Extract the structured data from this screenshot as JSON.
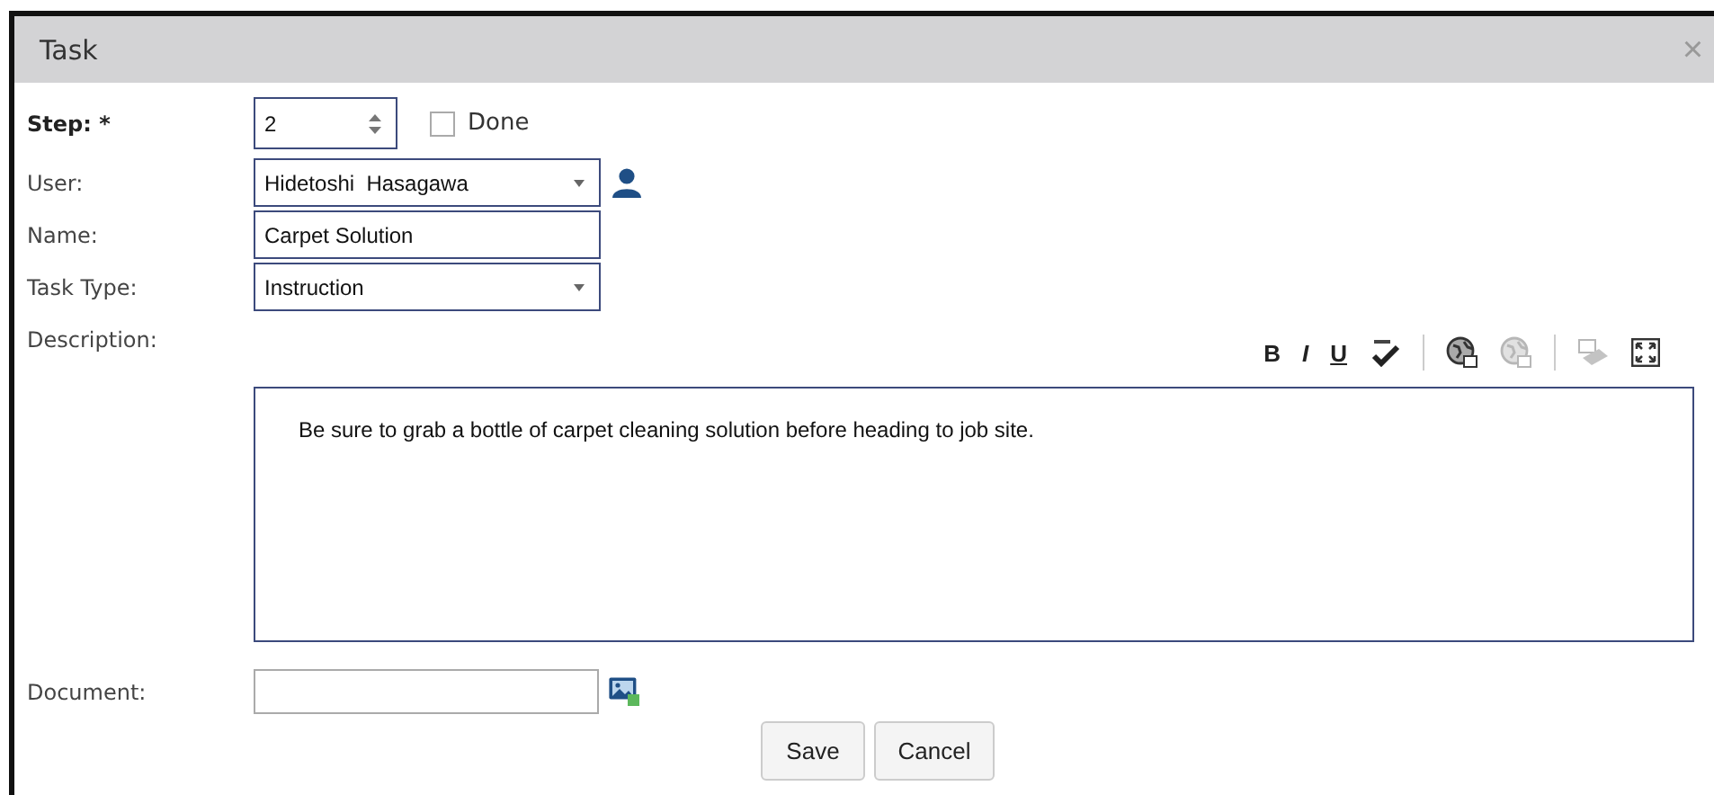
{
  "window": {
    "title": "Task",
    "close": "×"
  },
  "step": {
    "label": "Step:",
    "required_mark": "*",
    "value": "2"
  },
  "done": {
    "label": "Done",
    "checked": false
  },
  "user": {
    "label": "User:",
    "value": "Hidetoshi  Hasagawa"
  },
  "name": {
    "label": "Name:",
    "value": "Carpet Solution"
  },
  "task_type": {
    "label": "Task Type:",
    "value": "Instruction"
  },
  "description": {
    "label": "Description:",
    "text": "Be sure to grab a bottle of carpet cleaning solution before heading to job site.",
    "toolbar": [
      {
        "kind": "bold",
        "label": "B",
        "disabled": false
      },
      {
        "kind": "italic",
        "label": "I",
        "disabled": false
      },
      {
        "kind": "underline",
        "label": "U",
        "disabled": false
      },
      {
        "kind": "spellcheck",
        "disabled": false
      },
      {
        "kind": "separator"
      },
      {
        "kind": "globe",
        "disabled": false
      },
      {
        "kind": "globe",
        "disabled": true
      },
      {
        "kind": "separator"
      },
      {
        "kind": "paste",
        "disabled": true
      },
      {
        "kind": "fullscreen",
        "disabled": false
      }
    ]
  },
  "document": {
    "label": "Document:"
  },
  "buttons": [
    "Save",
    "Cancel"
  ]
}
